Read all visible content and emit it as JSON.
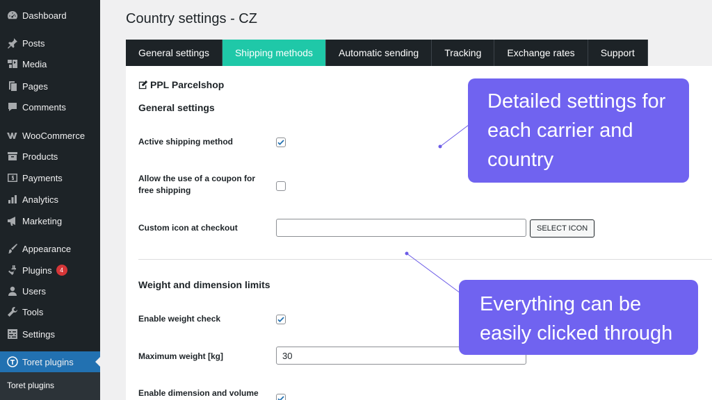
{
  "sidebar": {
    "items": [
      {
        "label": "Dashboard",
        "icon": "dashboard-icon"
      },
      {
        "label": "Posts",
        "icon": "pin-icon"
      },
      {
        "label": "Media",
        "icon": "media-icon"
      },
      {
        "label": "Pages",
        "icon": "pages-icon"
      },
      {
        "label": "Comments",
        "icon": "comment-icon"
      },
      {
        "label": "WooCommerce",
        "icon": "woocommerce-icon"
      },
      {
        "label": "Products",
        "icon": "archive-icon"
      },
      {
        "label": "Payments",
        "icon": "payments-icon"
      },
      {
        "label": "Analytics",
        "icon": "chart-bar-icon"
      },
      {
        "label": "Marketing",
        "icon": "megaphone-icon"
      },
      {
        "label": "Appearance",
        "icon": "paintbrush-icon"
      },
      {
        "label": "Plugins",
        "icon": "plugin-icon",
        "badge": "4"
      },
      {
        "label": "Users",
        "icon": "user-icon"
      },
      {
        "label": "Tools",
        "icon": "wrench-icon"
      },
      {
        "label": "Settings",
        "icon": "settings-icon"
      },
      {
        "label": "Toret plugins",
        "icon": "toret-icon"
      }
    ],
    "submenu_label": "Toret plugins"
  },
  "page": {
    "title": "Country settings - CZ",
    "tabs": [
      {
        "label": "General settings"
      },
      {
        "label": "Shipping methods"
      },
      {
        "label": "Automatic sending"
      },
      {
        "label": "Tracking"
      },
      {
        "label": "Exchange rates"
      },
      {
        "label": "Support"
      }
    ],
    "active_tab": "Shipping methods"
  },
  "panel": {
    "carrier": "PPL Parcelshop",
    "general_settings_title": "General settings",
    "active_shipping_label": "Active shipping method",
    "active_shipping_checked": true,
    "coupon_label": "Allow the use of a coupon for free shipping",
    "coupon_checked": false,
    "custom_icon_label": "Custom icon at checkout",
    "custom_icon_value": "",
    "select_icon_label": "SELECT ICON",
    "limits_title": "Weight and dimension limits",
    "weight_check_label": "Enable weight check",
    "weight_check_checked": true,
    "max_weight_label": "Maximum weight [kg]",
    "max_weight_value": "30",
    "dimension_label": "Enable dimension and volume",
    "dimension_checked": true
  },
  "callouts": {
    "first": "Detailed settings for each carrier and country",
    "second": "Everything can be easily clicked through"
  },
  "colors": {
    "sidebar_bg": "#1d2327",
    "active_menu": "#2271b1",
    "active_tab": "#1fc8a8",
    "callout": "#7063f0",
    "badge": "#d63638"
  }
}
